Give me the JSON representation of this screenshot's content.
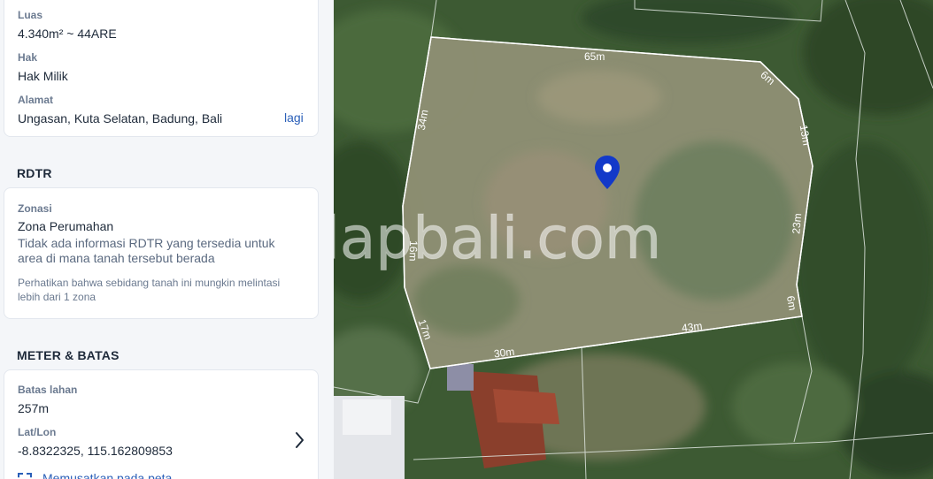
{
  "property": {
    "luas_label": "Luas",
    "luas_value": "4.340m² ~ 44ARE",
    "hak_label": "Hak",
    "hak_value": "Hak Milik",
    "alamat_label": "Alamat",
    "alamat_value": "Ungasan, Kuta Selatan, Badung, Bali",
    "more_link": "lagi"
  },
  "rdtr": {
    "title": "RDTR",
    "zonasi_label": "Zonasi",
    "zonasi_value": "Zona Perumahan",
    "info": "Tidak ada informasi RDTR yang tersedia untuk area di mana tanah tersebut berada",
    "notice": "Perhatikan bahwa sebidang tanah ini mungkin melintasi lebih dari 1 zona"
  },
  "meter": {
    "title": "METER & BATAS",
    "batas_label": "Batas lahan",
    "batas_value": "257m",
    "latlon_label": "Lat/Lon",
    "latlon_value": "-8.8322325, 115.162809853",
    "center_link": "Memusatkan pada peta"
  },
  "map": {
    "watermark": "dapbali.com",
    "edges": [
      {
        "label": "65m"
      },
      {
        "label": "6m"
      },
      {
        "label": "13m"
      },
      {
        "label": "23m"
      },
      {
        "label": "6m"
      },
      {
        "label": "43m"
      },
      {
        "label": "30m"
      },
      {
        "label": "17m"
      },
      {
        "label": "16m"
      },
      {
        "label": "34m"
      }
    ],
    "marker_color": "#1239c9",
    "boundary_color": "#ffffff"
  },
  "icons": {
    "chevron": "chevron-right-icon",
    "center": "crosshair-icon",
    "marker": "map-pin-icon"
  }
}
